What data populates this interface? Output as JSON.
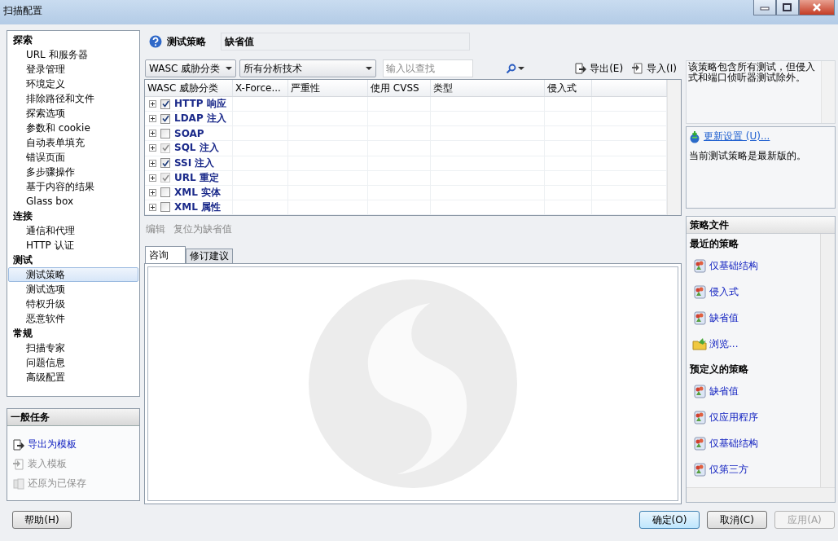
{
  "window": {
    "title": "扫描配置"
  },
  "nav": [
    {
      "label": "探索",
      "items": [
        {
          "label": "URL 和服务器",
          "selected": false
        },
        {
          "label": "登录管理",
          "selected": false
        },
        {
          "label": "环境定义",
          "selected": false
        },
        {
          "label": "排除路径和文件",
          "selected": false
        },
        {
          "label": "探索选项",
          "selected": false
        },
        {
          "label": "参数和 cookie",
          "selected": false
        },
        {
          "label": "自动表单填充",
          "selected": false
        },
        {
          "label": "错误页面",
          "selected": false
        },
        {
          "label": "多步骤操作",
          "selected": false
        },
        {
          "label": "基于内容的结果",
          "selected": false
        },
        {
          "label": "Glass box",
          "selected": false
        }
      ]
    },
    {
      "label": "连接",
      "items": [
        {
          "label": "通信和代理",
          "selected": false
        },
        {
          "label": "HTTP 认证",
          "selected": false
        }
      ]
    },
    {
      "label": "测试",
      "items": [
        {
          "label": "测试策略",
          "selected": true
        },
        {
          "label": "测试选项",
          "selected": false
        },
        {
          "label": "特权升级",
          "selected": false
        },
        {
          "label": "恶意软件",
          "selected": false
        }
      ]
    },
    {
      "label": "常规",
      "items": [
        {
          "label": "扫描专家",
          "selected": false
        },
        {
          "label": "问题信息",
          "selected": false
        },
        {
          "label": "高级配置",
          "selected": false
        }
      ]
    }
  ],
  "tasks": {
    "title": "一般任务",
    "items": [
      {
        "label": "导出为模板",
        "kind": "export",
        "disabled": false
      },
      {
        "label": "装入模板",
        "kind": "import",
        "disabled": true
      },
      {
        "label": "还原为已保存",
        "kind": "restore",
        "disabled": true
      }
    ]
  },
  "policy": {
    "label": "测试策略",
    "name": "缺省值"
  },
  "toolbar": {
    "group_by": "WASC 威胁分类",
    "technique": "所有分析技术",
    "search": {
      "placeholder": "输入以查找"
    },
    "export": "导出(E)",
    "import": "导入(I)"
  },
  "table": {
    "columns": [
      "WASC 威胁分类",
      "X-Force...",
      "严重性",
      "使用 CVSS",
      "类型",
      "侵入式"
    ],
    "rows": [
      {
        "name": "HTTP 响应",
        "checked": true,
        "disabled": false
      },
      {
        "name": "LDAP 注入",
        "checked": true,
        "disabled": false
      },
      {
        "name": "SOAP",
        "checked": false,
        "disabled": false
      },
      {
        "name": "SQL 注入",
        "checked": true,
        "disabled": true
      },
      {
        "name": "SSI 注入",
        "checked": true,
        "disabled": false
      },
      {
        "name": "URL 重定",
        "checked": true,
        "disabled": true
      },
      {
        "name": "XML 实体",
        "checked": false,
        "disabled": false
      },
      {
        "name": "XML 属性",
        "checked": false,
        "disabled": false
      }
    ]
  },
  "actions": [
    {
      "label": "编辑",
      "disabled": true
    },
    {
      "label": "复位为缺省值",
      "disabled": true
    }
  ],
  "tabs": [
    {
      "label": "咨询",
      "selected": true
    },
    {
      "label": "修订建议",
      "selected": false
    }
  ],
  "description": "该策略包含所有测试，但侵入式和端口侦听器测试除外。",
  "update": {
    "link": "更新设置 (U)...",
    "status": "当前测试策略是最新版的。"
  },
  "policy_files": {
    "title": "策略文件",
    "groups": [
      {
        "title": "最近的策略",
        "items": [
          {
            "label": "仅基础结构",
            "kind": "policy"
          },
          {
            "label": "侵入式",
            "kind": "policy"
          },
          {
            "label": "缺省值",
            "kind": "policy"
          },
          {
            "label": "浏览...",
            "kind": "browse"
          }
        ]
      },
      {
        "title": "预定义的策略",
        "items": [
          {
            "label": "缺省值",
            "kind": "policy"
          },
          {
            "label": "仅应用程序",
            "kind": "policy"
          },
          {
            "label": "仅基础结构",
            "kind": "policy"
          },
          {
            "label": "仅第三方",
            "kind": "policy"
          }
        ]
      }
    ]
  },
  "help_button": "帮助(H)",
  "buttons": [
    {
      "label": "确定(O)",
      "default": true,
      "disabled": false
    },
    {
      "label": "取消(C)",
      "default": false,
      "disabled": false
    },
    {
      "label": "应用(A)",
      "default": false,
      "disabled": true
    }
  ]
}
